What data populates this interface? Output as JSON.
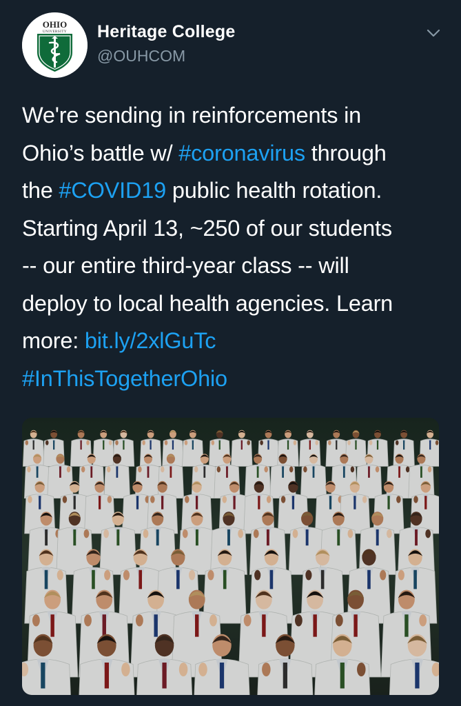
{
  "tweet": {
    "author": {
      "name": "Heritage College",
      "handle": "@OUHCOM",
      "avatar_icon": "ohio-university-shield-logo",
      "logo_text": "OHIO",
      "logo_subtext": "UNIVERSITY"
    },
    "menu_icon": "chevron-down-icon",
    "text": {
      "l1": "We're sending in reinforcements in",
      "l2_a": "Ohio’s battle w/ ",
      "l2_tag": "#coronavirus",
      "l2_b": " through",
      "l3_a": "the ",
      "l3_tag": "#COVID19",
      "l3_b": " public health rotation.",
      "l4": "Starting April 13, ~250 of our students",
      "l5": "-- our entire third-year class -- will",
      "l6": "deploy to local health agencies. Learn",
      "l7_a": "more: ",
      "l7_link": "bit.ly/2xlGuTc",
      "l8_tag": "#InThisTogetherOhio"
    },
    "media": {
      "kind": "photo",
      "description_icon": "students-white-coat-ceremony-photo"
    }
  },
  "colors": {
    "background": "#15202b",
    "text": "#ffffff",
    "secondary_text": "#8899a6",
    "link": "#1da1f2",
    "logo_green": "#0f6b3a"
  }
}
